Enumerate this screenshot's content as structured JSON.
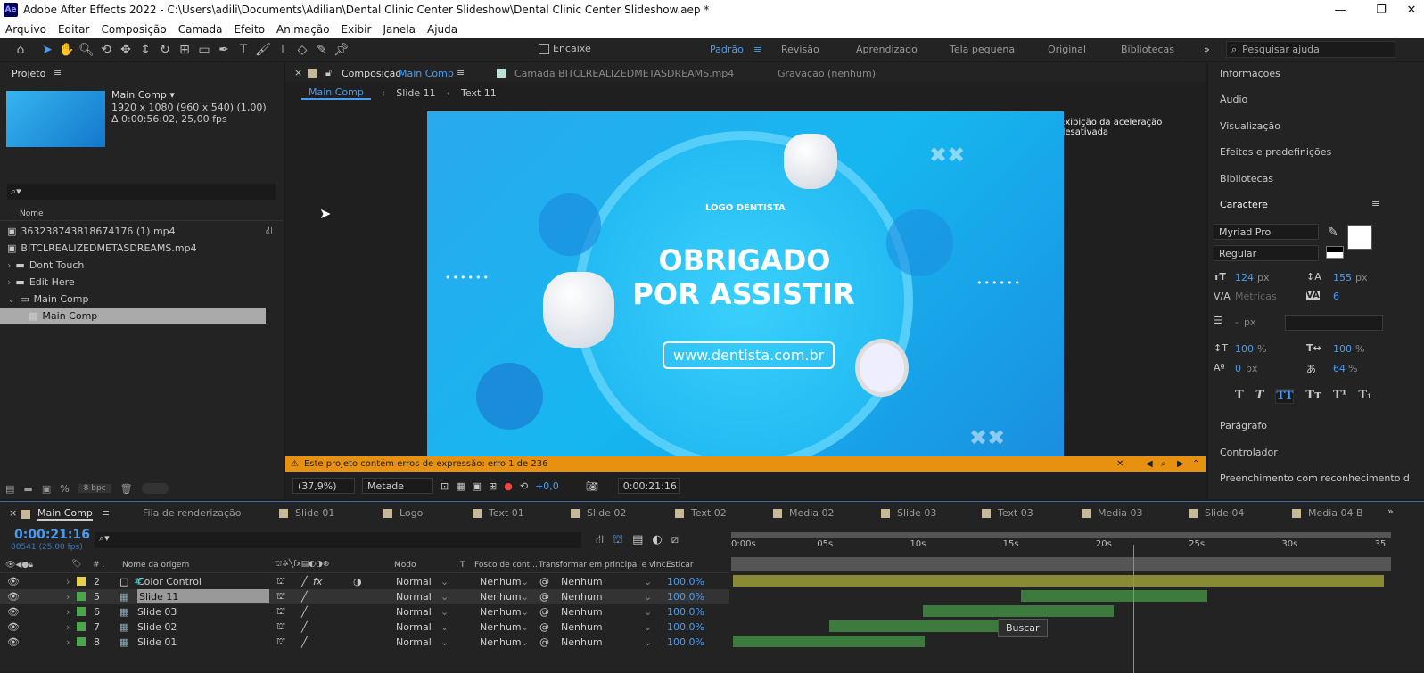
{
  "window": {
    "title": "Adobe After Effects 2022 - C:\\Users\\adili\\Documents\\Adilian\\Dental Clinic Center Slideshow\\Dental Clinic Center Slideshow.aep *",
    "app_icon": "Ae"
  },
  "menu": [
    "Arquivo",
    "Editar",
    "Composição",
    "Camada",
    "Efeito",
    "Animação",
    "Exibir",
    "Janela",
    "Ajuda"
  ],
  "toolbar": {
    "snap_label": "Encaixe",
    "workspaces": [
      "Padrão",
      "Revisão",
      "Aprendizado",
      "Tela pequena",
      "Original",
      "Bibliotecas"
    ],
    "active_workspace": "Padrão",
    "search_placeholder": "Pesquisar ajuda"
  },
  "project": {
    "title": "Projeto",
    "comp_name": "Main Comp ▾",
    "comp_info1": "1920 x 1080  (960 x 540) (1,00)",
    "comp_info2": "Δ 0:00:56:02, 25,00 fps",
    "col_name": "Nome",
    "items": [
      {
        "name": "363238743818674176 (1).mp4",
        "type": "video",
        "indent": 0
      },
      {
        "name": "BITCLREALIZEDMETASDREAMS.mp4",
        "type": "video",
        "indent": 0
      },
      {
        "name": "Dont Touch",
        "type": "folder",
        "indent": 0
      },
      {
        "name": "Edit Here",
        "type": "folder",
        "indent": 0
      },
      {
        "name": "Main Comp",
        "type": "folder-open",
        "indent": 0
      },
      {
        "name": "Main Comp",
        "type": "comp",
        "indent": 1,
        "selected": true
      }
    ],
    "bpc": "8 bpc"
  },
  "comp": {
    "tab_label": "Composição",
    "tab_comp": "Main Comp",
    "layer_tab": "Camada  BITCLREALIZEDMETASDREAMS.mp4",
    "recording": "Gravação  (nenhum)",
    "breadcrumbs": [
      "Main Comp",
      "Slide 11",
      "Text 11"
    ],
    "accel_notice": "Exibição da aceleração desativada",
    "frame": {
      "logo": "LOGO DENTISTA",
      "headline1": "OBRIGADO",
      "headline2": "POR ASSISTIR",
      "url": "www.dentista.com.br"
    },
    "warning": "Este projeto contém erros de expressão: erro 1 de 236",
    "zoom": "(37,9%)",
    "resolution": "Metade",
    "exposure": "+0,0",
    "timecode": "0:00:21:16"
  },
  "right": {
    "top_items": [
      "Informações",
      "Áudio",
      "Visualização",
      "Efeitos e predefinições",
      "Bibliotecas"
    ],
    "character": {
      "title": "Caractere",
      "font": "Myriad Pro",
      "style": "Regular",
      "size": "124",
      "size_unit": "px",
      "leading": "155",
      "leading_unit": "px",
      "kerning": "Métricas",
      "tracking": "6",
      "stroke": "-",
      "stroke_unit": "px",
      "vscale": "100",
      "vscale_unit": "%",
      "hscale": "100",
      "hscale_unit": "%",
      "baseline": "0",
      "baseline_unit": "px",
      "tsume": "64",
      "tsume_unit": "%",
      "styles": [
        "T",
        "T",
        "TT",
        "Tт",
        "T¹",
        "T₁"
      ]
    },
    "bottom_items": [
      "Parágrafo",
      "Controlador",
      "Preenchimento com reconhecimento d"
    ]
  },
  "timeline": {
    "tabs": [
      "Main Comp",
      "Fila de renderização",
      "Slide 01",
      "Logo",
      "Text 01",
      "Slide 02",
      "Text 02",
      "Media 02",
      "Slide 03",
      "Text 03",
      "Media 03",
      "Slide 04",
      "Media 04 B"
    ],
    "timecode": "0:00:21:16",
    "frame_info": "00541 (25.00 fps)",
    "columns": {
      "name": "Nome da origem",
      "mode": "Modo",
      "t": "T",
      "matte": "Fosco de cont...",
      "parent": "Transformar em principal e vinc...",
      "stretch": "Esticar"
    },
    "ruler": [
      "0:00s",
      "05s",
      "10s",
      "15s",
      "20s",
      "25s",
      "30s",
      "35"
    ],
    "layers": [
      {
        "num": "2",
        "name": "Color Control",
        "label_color": "#e6d24a",
        "type": "solid",
        "mode": "Normal",
        "matte": "Nenhum",
        "parent": "Nenhum",
        "stretch": "100,0%",
        "fx": true,
        "start": 0,
        "end": 35
      },
      {
        "num": "5",
        "name": "Slide 11",
        "label_color": "#4aa84a",
        "type": "comp",
        "mode": "Normal",
        "matte": "Nenhum",
        "parent": "Nenhum",
        "stretch": "100,0%",
        "selected": true,
        "start": 15.5,
        "end": 25.5
      },
      {
        "num": "6",
        "name": "Slide 03",
        "label_color": "#4aa84a",
        "type": "comp",
        "mode": "Normal",
        "matte": "Nenhum",
        "parent": "Nenhum",
        "stretch": "100,0%",
        "start": 10.2,
        "end": 20.5
      },
      {
        "num": "7",
        "name": "Slide 02",
        "label_color": "#4aa84a",
        "type": "comp",
        "mode": "Normal",
        "matte": "Nenhum",
        "parent": "Nenhum",
        "stretch": "100,0%",
        "start": 5.2,
        "end": 15.5
      },
      {
        "num": "8",
        "name": "Slide 01",
        "label_color": "#4aa84a",
        "type": "comp",
        "mode": "Normal",
        "matte": "Nenhum",
        "parent": "Nenhum",
        "stretch": "100,0%",
        "start": 0,
        "end": 10.3
      }
    ],
    "current_time_s": 21.64,
    "tooltip": "Buscar"
  },
  "colors": {
    "accent": "#4a9cf0",
    "warning": "#e8900f",
    "panel": "#232323"
  }
}
